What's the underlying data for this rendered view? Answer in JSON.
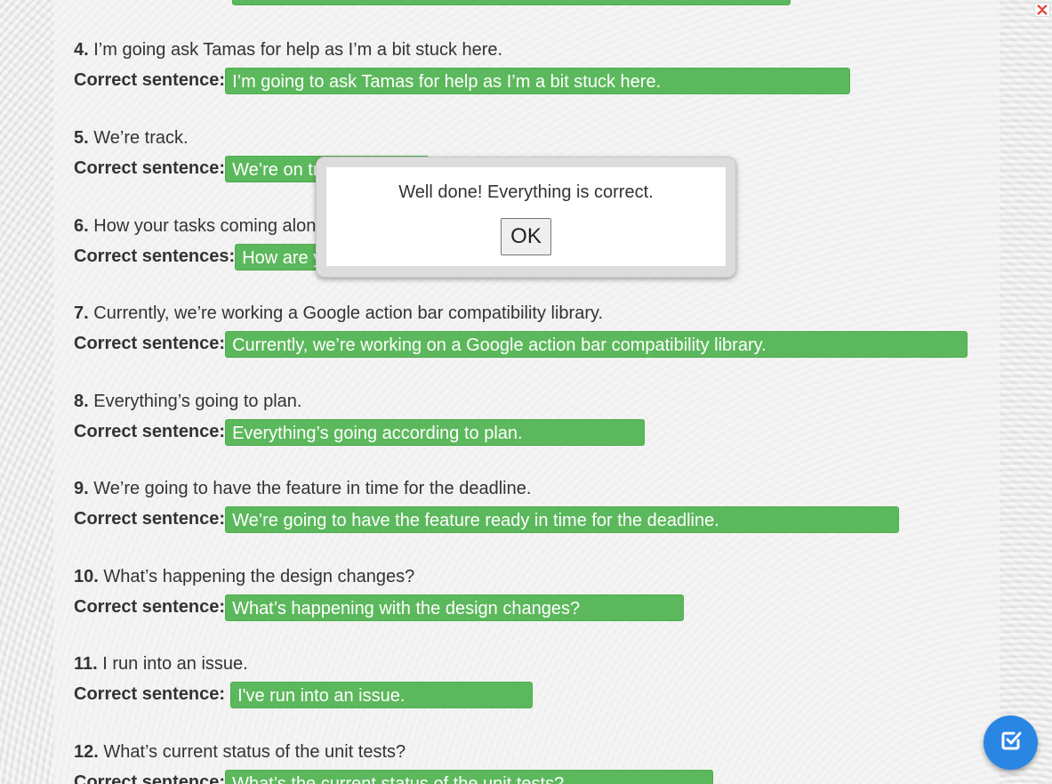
{
  "exercise": {
    "items": [
      {
        "number": "4.",
        "question": "I’m going ask Tamas for help as I’m a bit stuck here.",
        "label": "Correct sentence:",
        "answer": "I’m going to ask Tamas for help as I’m a bit stuck here."
      },
      {
        "number": "5.",
        "question": "We’re track.",
        "label": "Correct sentence:",
        "answer": "We’re on track."
      },
      {
        "number": "6.",
        "question": "How your tasks coming along?",
        "label": "Correct sentences:",
        "answer": "How are your tasks coming along?"
      },
      {
        "number": "7.",
        "question": "Currently, we’re working a Google action bar compatibility library.",
        "label": "Correct sentence:",
        "answer": "Currently, we’re working on a Google action bar compatibility library."
      },
      {
        "number": "8.",
        "question": "Everything’s going to plan.",
        "label": "Correct sentence:",
        "answer": "Everything’s going according to plan."
      },
      {
        "number": "9.",
        "question": "We’re going to have the feature in time for the deadline.",
        "label": "Correct sentence:",
        "answer": "We’re going to have the feature ready in time for the deadline."
      },
      {
        "number": "10.",
        "question": "What’s happening the design changes?",
        "label": "Correct sentence:",
        "answer": "What’s happening with the design changes?"
      },
      {
        "number": "11.",
        "question": "I run into an issue.",
        "label": "Correct sentence:",
        "answer": "I've run into an issue."
      },
      {
        "number": "12.",
        "question": "What’s current status of the unit tests?",
        "label": "Correct sentence:",
        "answer": "What’s the current status of the unit tests?"
      }
    ]
  },
  "dialog": {
    "message": "Well done! Everything is correct.",
    "ok_label": "OK"
  },
  "icons": {
    "close": "close-icon",
    "check_button": "checkbox-check-icon"
  },
  "colors": {
    "correct_fill": "#5cb85c",
    "fab_blue": "#2a86e3"
  }
}
